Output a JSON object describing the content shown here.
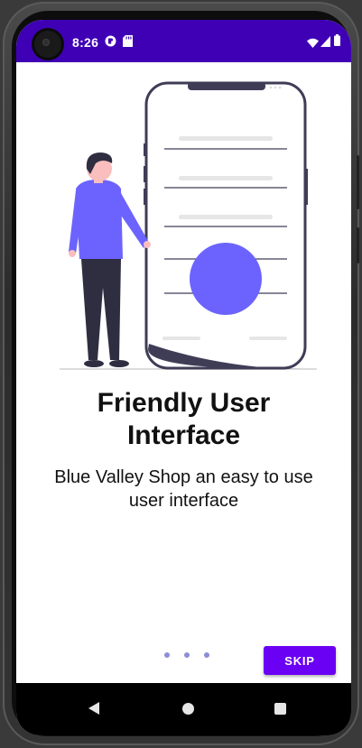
{
  "status_bar": {
    "time": "8:26",
    "bg_color": "#3f00b5",
    "icons_left": [
      "camera-privacy-icon",
      "sd-card-icon"
    ],
    "icons_right": [
      "wifi-icon",
      "signal-icon",
      "battery-icon"
    ]
  },
  "onboarding": {
    "title": "Friendly User\nInterface",
    "subtitle": "Blue Valley Shop an easy to use\nuser interface",
    "illustration": "person-with-phone-illustration",
    "accent_color": "#6c63ff",
    "page_count": 3,
    "current_page": 1
  },
  "actions": {
    "skip_label": "SKIP",
    "skip_color": "#6a00f4"
  },
  "nav_bar": {
    "icons": [
      "back-icon",
      "home-icon",
      "recents-icon"
    ]
  }
}
